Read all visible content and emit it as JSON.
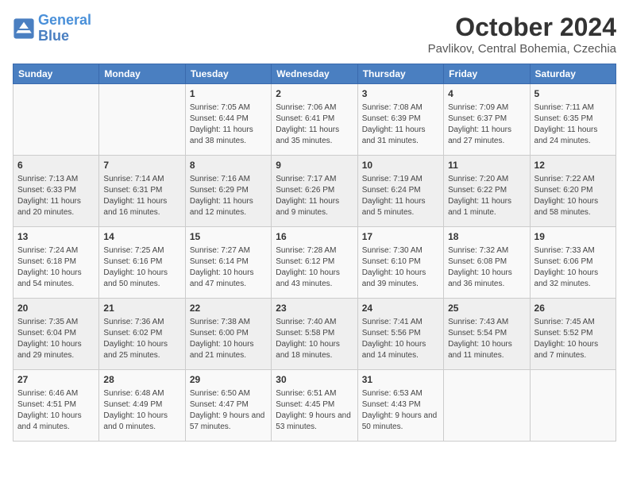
{
  "header": {
    "logo_line1": "General",
    "logo_line2": "Blue",
    "month": "October 2024",
    "location": "Pavlikov, Central Bohemia, Czechia"
  },
  "days_of_week": [
    "Sunday",
    "Monday",
    "Tuesday",
    "Wednesday",
    "Thursday",
    "Friday",
    "Saturday"
  ],
  "weeks": [
    [
      {
        "day": "",
        "info": ""
      },
      {
        "day": "",
        "info": ""
      },
      {
        "day": "1",
        "info": "Sunrise: 7:05 AM\nSunset: 6:44 PM\nDaylight: 11 hours and 38 minutes."
      },
      {
        "day": "2",
        "info": "Sunrise: 7:06 AM\nSunset: 6:41 PM\nDaylight: 11 hours and 35 minutes."
      },
      {
        "day": "3",
        "info": "Sunrise: 7:08 AM\nSunset: 6:39 PM\nDaylight: 11 hours and 31 minutes."
      },
      {
        "day": "4",
        "info": "Sunrise: 7:09 AM\nSunset: 6:37 PM\nDaylight: 11 hours and 27 minutes."
      },
      {
        "day": "5",
        "info": "Sunrise: 7:11 AM\nSunset: 6:35 PM\nDaylight: 11 hours and 24 minutes."
      }
    ],
    [
      {
        "day": "6",
        "info": "Sunrise: 7:13 AM\nSunset: 6:33 PM\nDaylight: 11 hours and 20 minutes."
      },
      {
        "day": "7",
        "info": "Sunrise: 7:14 AM\nSunset: 6:31 PM\nDaylight: 11 hours and 16 minutes."
      },
      {
        "day": "8",
        "info": "Sunrise: 7:16 AM\nSunset: 6:29 PM\nDaylight: 11 hours and 12 minutes."
      },
      {
        "day": "9",
        "info": "Sunrise: 7:17 AM\nSunset: 6:26 PM\nDaylight: 11 hours and 9 minutes."
      },
      {
        "day": "10",
        "info": "Sunrise: 7:19 AM\nSunset: 6:24 PM\nDaylight: 11 hours and 5 minutes."
      },
      {
        "day": "11",
        "info": "Sunrise: 7:20 AM\nSunset: 6:22 PM\nDaylight: 11 hours and 1 minute."
      },
      {
        "day": "12",
        "info": "Sunrise: 7:22 AM\nSunset: 6:20 PM\nDaylight: 10 hours and 58 minutes."
      }
    ],
    [
      {
        "day": "13",
        "info": "Sunrise: 7:24 AM\nSunset: 6:18 PM\nDaylight: 10 hours and 54 minutes."
      },
      {
        "day": "14",
        "info": "Sunrise: 7:25 AM\nSunset: 6:16 PM\nDaylight: 10 hours and 50 minutes."
      },
      {
        "day": "15",
        "info": "Sunrise: 7:27 AM\nSunset: 6:14 PM\nDaylight: 10 hours and 47 minutes."
      },
      {
        "day": "16",
        "info": "Sunrise: 7:28 AM\nSunset: 6:12 PM\nDaylight: 10 hours and 43 minutes."
      },
      {
        "day": "17",
        "info": "Sunrise: 7:30 AM\nSunset: 6:10 PM\nDaylight: 10 hours and 39 minutes."
      },
      {
        "day": "18",
        "info": "Sunrise: 7:32 AM\nSunset: 6:08 PM\nDaylight: 10 hours and 36 minutes."
      },
      {
        "day": "19",
        "info": "Sunrise: 7:33 AM\nSunset: 6:06 PM\nDaylight: 10 hours and 32 minutes."
      }
    ],
    [
      {
        "day": "20",
        "info": "Sunrise: 7:35 AM\nSunset: 6:04 PM\nDaylight: 10 hours and 29 minutes."
      },
      {
        "day": "21",
        "info": "Sunrise: 7:36 AM\nSunset: 6:02 PM\nDaylight: 10 hours and 25 minutes."
      },
      {
        "day": "22",
        "info": "Sunrise: 7:38 AM\nSunset: 6:00 PM\nDaylight: 10 hours and 21 minutes."
      },
      {
        "day": "23",
        "info": "Sunrise: 7:40 AM\nSunset: 5:58 PM\nDaylight: 10 hours and 18 minutes."
      },
      {
        "day": "24",
        "info": "Sunrise: 7:41 AM\nSunset: 5:56 PM\nDaylight: 10 hours and 14 minutes."
      },
      {
        "day": "25",
        "info": "Sunrise: 7:43 AM\nSunset: 5:54 PM\nDaylight: 10 hours and 11 minutes."
      },
      {
        "day": "26",
        "info": "Sunrise: 7:45 AM\nSunset: 5:52 PM\nDaylight: 10 hours and 7 minutes."
      }
    ],
    [
      {
        "day": "27",
        "info": "Sunrise: 6:46 AM\nSunset: 4:51 PM\nDaylight: 10 hours and 4 minutes."
      },
      {
        "day": "28",
        "info": "Sunrise: 6:48 AM\nSunset: 4:49 PM\nDaylight: 10 hours and 0 minutes."
      },
      {
        "day": "29",
        "info": "Sunrise: 6:50 AM\nSunset: 4:47 PM\nDaylight: 9 hours and 57 minutes."
      },
      {
        "day": "30",
        "info": "Sunrise: 6:51 AM\nSunset: 4:45 PM\nDaylight: 9 hours and 53 minutes."
      },
      {
        "day": "31",
        "info": "Sunrise: 6:53 AM\nSunset: 4:43 PM\nDaylight: 9 hours and 50 minutes."
      },
      {
        "day": "",
        "info": ""
      },
      {
        "day": "",
        "info": ""
      }
    ]
  ]
}
